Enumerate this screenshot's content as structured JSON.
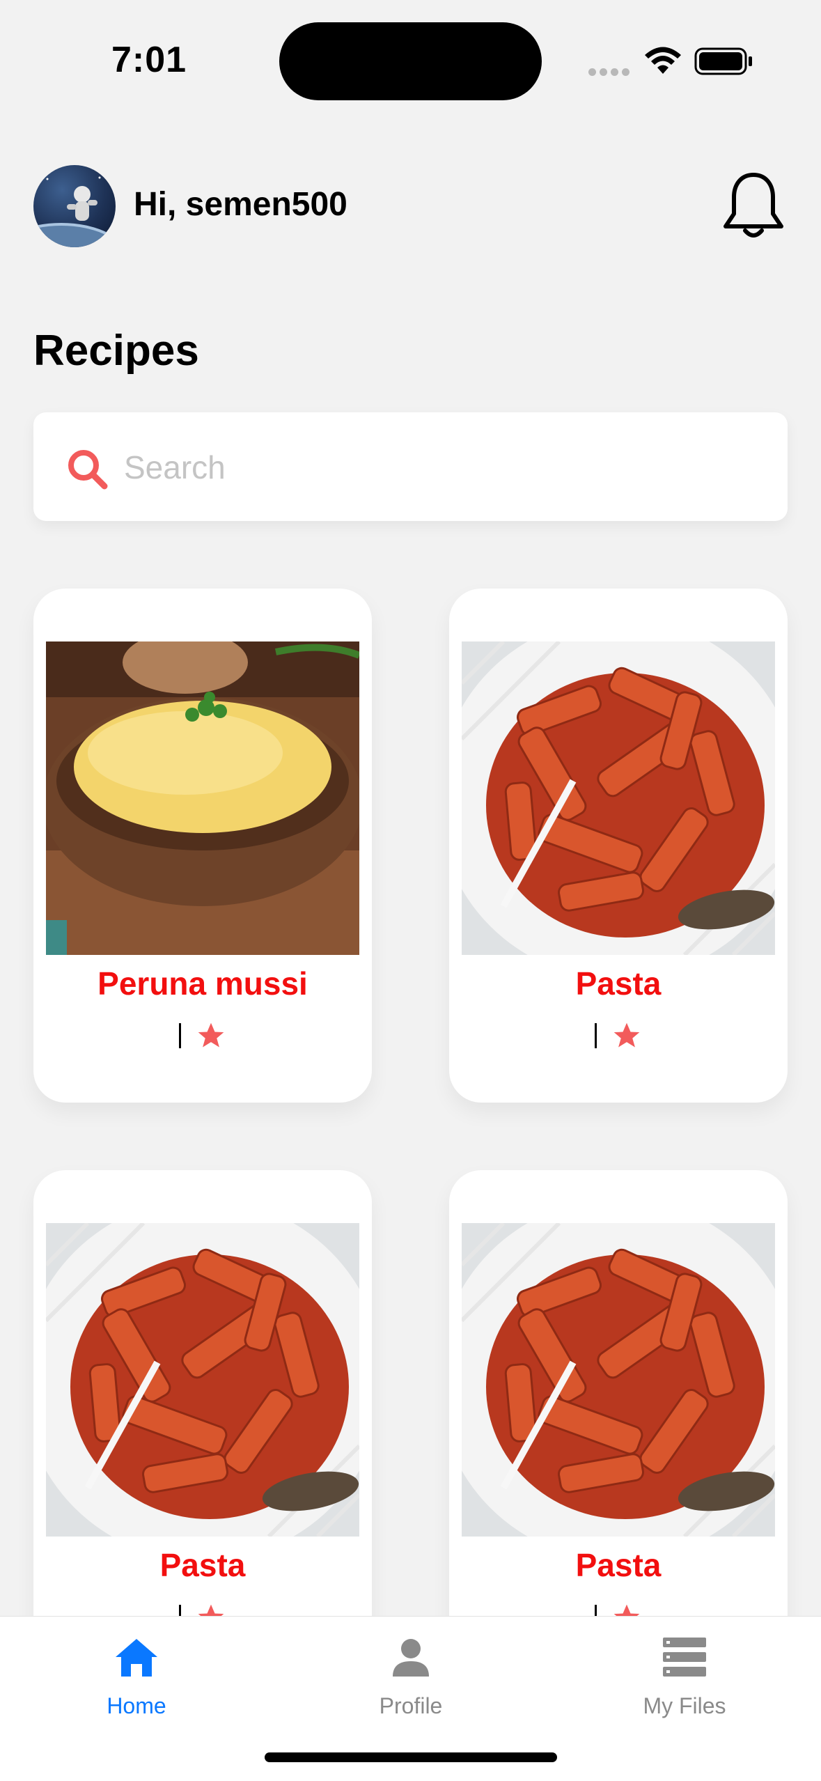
{
  "status_bar": {
    "time": "7:01"
  },
  "header": {
    "greeting": "Hi, semen500"
  },
  "page": {
    "title": "Recipes"
  },
  "search": {
    "placeholder": "Search",
    "value": ""
  },
  "recipes": [
    {
      "title": "Peruna mussi",
      "rating_sep": "|",
      "image": "mashed-potatoes"
    },
    {
      "title": "Pasta",
      "rating_sep": "|",
      "image": "pasta"
    },
    {
      "title": "Pasta",
      "rating_sep": "|",
      "image": "pasta"
    },
    {
      "title": "Pasta",
      "rating_sep": "|",
      "image": "pasta"
    }
  ],
  "bottom_nav": {
    "items": [
      {
        "label": "Home",
        "icon": "home-icon",
        "active": true
      },
      {
        "label": "Profile",
        "icon": "person-icon",
        "active": false
      },
      {
        "label": "My Files",
        "icon": "files-icon",
        "active": false
      }
    ]
  },
  "colors": {
    "accent": "#0a78ff",
    "recipe_title": "#f20f0f",
    "star": "#f25b5b",
    "search_icon": "#f25b5b",
    "inactive_nav": "#8a8a8a"
  }
}
